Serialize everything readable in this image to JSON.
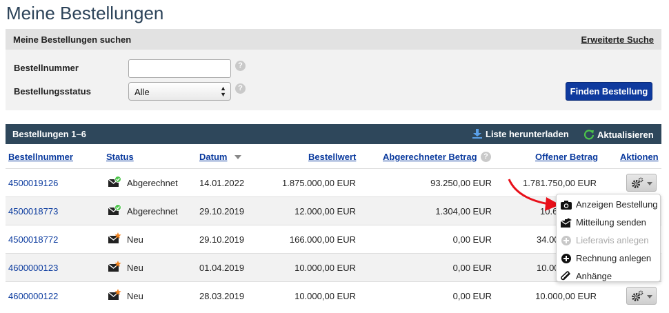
{
  "page_title": "Meine Bestellungen",
  "search": {
    "title": "Meine Bestellungen suchen",
    "advanced_link": "Erweiterte Suche",
    "order_number_label": "Bestellnummer",
    "order_number_value": "",
    "order_status_label": "Bestellungsstatus",
    "order_status_value": "Alle",
    "help_glyph": "?",
    "find_button": "Finden Bestellung"
  },
  "list": {
    "title": "Bestellungen 1–6",
    "download_label": "Liste herunterladen",
    "refresh_label": "Aktualisieren",
    "columns": {
      "order_number": "Bestellnummer",
      "status": "Status",
      "date": "Datum",
      "order_value": "Bestellwert",
      "billed_amount": "Abgerechneter Betrag",
      "open_amount": "Offener Betrag",
      "actions": "Aktionen"
    },
    "rows": [
      {
        "order_number": "4500019126",
        "status": "Abgerechnet",
        "status_icon": "envelope-check-icon",
        "date": "14.01.2022",
        "order_value": "1.875.000,00 EUR",
        "billed_amount": "93.250,00 EUR",
        "open_amount": "1.781.750,00 EUR"
      },
      {
        "order_number": "4500018773",
        "status": "Abgerechnet",
        "status_icon": "envelope-check-icon",
        "date": "29.10.2019",
        "order_value": "12.000,00 EUR",
        "billed_amount": "1.304,00 EUR",
        "open_amount": "10.6"
      },
      {
        "order_number": "4500018772",
        "status": "Neu",
        "status_icon": "envelope-new-icon",
        "date": "29.10.2019",
        "order_value": "166.000,00 EUR",
        "billed_amount": "0,00 EUR",
        "open_amount": "34.00"
      },
      {
        "order_number": "4600000123",
        "status": "Neu",
        "status_icon": "envelope-new-icon",
        "date": "01.04.2019",
        "order_value": "10.000,00 EUR",
        "billed_amount": "0,00 EUR",
        "open_amount": "10.00"
      },
      {
        "order_number": "4600000122",
        "status": "Neu",
        "status_icon": "envelope-new-icon",
        "date": "28.03.2019",
        "order_value": "10.000,00 EUR",
        "billed_amount": "0,00 EUR",
        "open_amount": "10.000,00 EUR"
      }
    ]
  },
  "action_menu": {
    "items": [
      {
        "label": "Anzeigen Bestellung",
        "icon": "camera-icon",
        "enabled": true
      },
      {
        "label": "Mitteilung senden",
        "icon": "send-message-icon",
        "enabled": true
      },
      {
        "label": "Lieferavis anlegen",
        "icon": "plus-circle-icon",
        "enabled": false
      },
      {
        "label": "Rechnung anlegen",
        "icon": "plus-circle-icon",
        "enabled": true
      },
      {
        "label": "Anhänge",
        "icon": "paperclip-icon",
        "enabled": true
      }
    ]
  },
  "colors": {
    "title": "#2b4258",
    "header_bar": "#2e475b",
    "link": "#0a3a9e",
    "primary_button": "#0f3a9e",
    "annotation_arrow": "#e8101a"
  }
}
